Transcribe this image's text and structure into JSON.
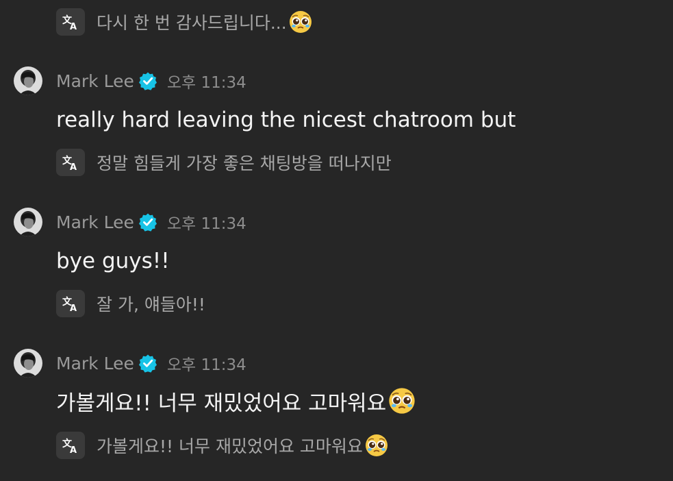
{
  "top_translation": {
    "text": "다시 한 번 감사드립니다...",
    "emoji": "pleading-face"
  },
  "messages": [
    {
      "author": "Mark Lee",
      "verified": true,
      "time": "오후 11:34",
      "text": "really hard leaving the nicest chatroom but",
      "translation": "정말 힘들게 가장 좋은 채팅방을 떠나지만"
    },
    {
      "author": "Mark Lee",
      "verified": true,
      "time": "오후 11:34",
      "text": "bye guys!!",
      "translation": "잘 가, 얘들아!!"
    },
    {
      "author": "Mark Lee",
      "verified": true,
      "time": "오후 11:34",
      "text": "가볼게요!! 너무 재밌었어요 고마워요",
      "text_emoji": "pleading-face",
      "translation": "가볼게요!! 너무 재밌었어요 고마워요",
      "translation_emoji": "pleading-face"
    }
  ],
  "icons": {
    "translate": "translate-icon",
    "verified": "verified-badge-icon",
    "avatar": "avatar"
  },
  "colors": {
    "background": "#262626",
    "verified_badge": "#17c3e6",
    "translate_button": "#3a3a3a"
  }
}
